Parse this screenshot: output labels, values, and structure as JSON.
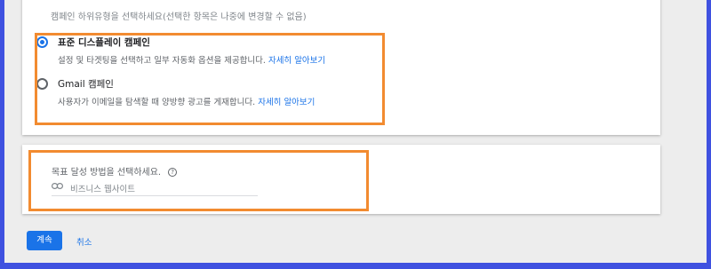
{
  "campaign_subtype": {
    "header": "캠페인 하위유형을 선택하세요(선택한 항목은 나중에 변경할 수 없음)",
    "options": [
      {
        "title": "표준 디스플레이 캠페인",
        "description": "설정 및 타겟팅을 선택하고 일부 자동화 옵션을 제공합니다.",
        "learn_more": "자세히 알아보기",
        "selected": true
      },
      {
        "title": "Gmail 캠페인",
        "description": "사용자가 이메일을 탐색할 때 양방향 광고를 게재합니다.",
        "learn_more": "자세히 알아보기",
        "selected": false
      }
    ]
  },
  "goal": {
    "label": "목표 달성 방법을 선택하세요.",
    "help_icon": "?",
    "input_placeholder": "비즈니스 웹사이트"
  },
  "actions": {
    "continue_label": "계속",
    "cancel_label": "취소"
  },
  "colors": {
    "outer_border": "#3f51e0",
    "highlight": "#f28b30",
    "accent": "#1a73e8"
  }
}
